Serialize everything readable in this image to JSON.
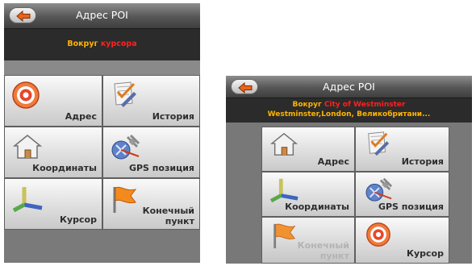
{
  "screen1": {
    "title": "Адрес POI",
    "subtitle": {
      "prefix": "Вокруг",
      "value": "курсора"
    },
    "buttons": [
      {
        "label": "Адрес",
        "icon": "target-icon"
      },
      {
        "label": "История",
        "icon": "history-checklist-icon"
      },
      {
        "label": "Координаты",
        "icon": "house-icon"
      },
      {
        "label": "GPS позиция",
        "icon": "satellite-icon"
      },
      {
        "label": "Курсор",
        "icon": "axes-icon"
      },
      {
        "label_line1": "Конечный",
        "label_line2": "пункт",
        "icon": "flag-icon"
      }
    ]
  },
  "screen2": {
    "title": "Адрес POI",
    "subtitle": {
      "prefix": "Вокруг",
      "value": "City of Westminster",
      "line2": "Westminster,London, Великобритани..."
    },
    "buttons": [
      {
        "label": "Адрес",
        "icon": "house-icon"
      },
      {
        "label": "История",
        "icon": "history-checklist-icon"
      },
      {
        "label": "Координаты",
        "icon": "axes-icon"
      },
      {
        "label": "GPS позиция",
        "icon": "satellite-icon"
      },
      {
        "label_line1": "Конечный",
        "label_line2": "пункт",
        "icon": "flag-icon",
        "disabled": true
      },
      {
        "label": "Курсор",
        "icon": "target-icon"
      }
    ]
  },
  "colors": {
    "subtitle_prefix": "#ffb400",
    "subtitle_value": "#ff2020",
    "subtitle_line2": "#ffb400",
    "arrow": "#e8641b"
  }
}
